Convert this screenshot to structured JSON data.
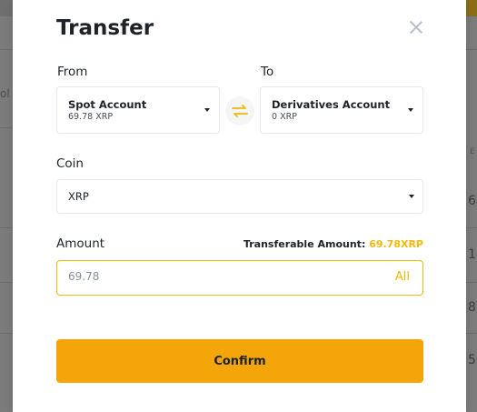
{
  "modal": {
    "title": "Transfer",
    "from": {
      "label": "From",
      "account": "Spot Account",
      "balance": "69.78 XRP"
    },
    "to": {
      "label": "To",
      "account": "Derivatives Account",
      "balance": "0 XRP"
    },
    "coin": {
      "label": "Coin",
      "selected": "XRP"
    },
    "amount": {
      "label": "Amount",
      "transferable_label": "Transferable Amount:",
      "transferable_value": "69.78XRP",
      "placeholder": "69.78",
      "all_label": "All"
    },
    "confirm_label": "Confirm"
  },
  "background": {
    "left_fragment": "ol",
    "right_header": "E",
    "right_values": [
      "6",
      "1",
      "8",
      "5"
    ]
  },
  "colors": {
    "accent": "#f0b90b",
    "button": "#f3a50a",
    "text": "#1e2329",
    "overlay": "#7b7b7b"
  },
  "icons": {
    "close": "close-icon",
    "swap": "swap-arrows-icon",
    "dropdown": "caret-down-icon"
  }
}
